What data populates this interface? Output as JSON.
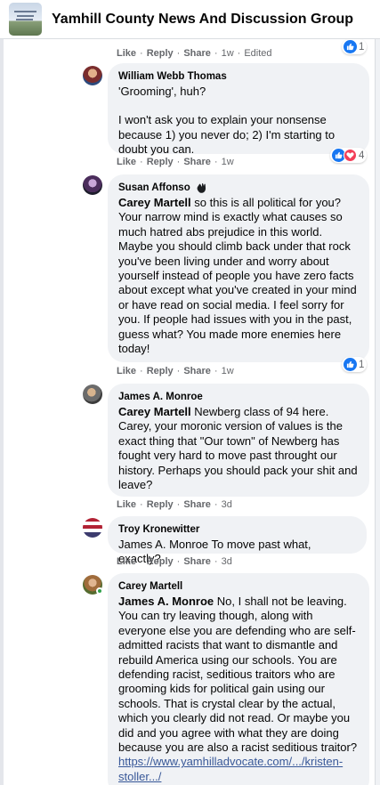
{
  "header": {
    "group_title": "Yamhill County News And Discussion Group"
  },
  "top_actions": {
    "like": "Like",
    "reply": "Reply",
    "share": "Share",
    "time": "1w",
    "edited": "Edited",
    "reaction_count": "1"
  },
  "comments": [
    {
      "author": "William Webb Thomas",
      "lines": [
        "'Grooming', huh?",
        "I won't ask you to explain your nonsense because 1) you never do; 2) I'm starting to doubt you can."
      ],
      "like": "Like",
      "reply": "Reply",
      "share": "Share",
      "time": "1w",
      "reaction_count": "4"
    },
    {
      "author": "Susan Affonso",
      "mention": "Carey Martell",
      "text": "so this is all political for you? Your narrow mind is exactly what causes so much hatred abs prejudice in this world. Maybe you should climb back under that rock you've been living under and worry about yourself instead of people you have zero facts about except what you've created in your mind or have read on social media. I feel sorry for you. If people had issues with you in the past, guess what? You made more enemies here today!",
      "like": "Like",
      "reply": "Reply",
      "share": "Share",
      "time": "1w",
      "reaction_count": "1"
    },
    {
      "author": "James A. Monroe",
      "mention": "Carey Martell",
      "text": "Newberg class of 94 here. Carey, your moronic version of values is the exact thing that \"Our town\" of Newberg has fought very hard to move past throught our history. Perhaps you should pack your shit and leave?",
      "like": "Like",
      "reply": "Reply",
      "share": "Share",
      "time": "3d"
    },
    {
      "author": "Troy Kronewitter",
      "text": "James A. Monroe To move past what, exactly?",
      "like": "Like",
      "reply": "Reply",
      "share": "Share",
      "time": "3d"
    },
    {
      "author": "Carey Martell",
      "mention": "James A. Monroe",
      "text": "No, I shall not be leaving. You can try leaving though, along with everyone else you are defending who are self-admitted racists that want to dismantle and rebuild America using our schools. You are defending racist, seditious traitors who are grooming kids for political gain using our schools. That is crystal clear by the actual, which you clearly did not read. Or maybe you did and you agree with what they are doing because you are also a racist seditious traitor?",
      "link": "https://www.yamhilladvocate.com/.../kristen-stoller.../"
    }
  ],
  "colors": {
    "bubble": "#f0f2f5",
    "link": "#385898",
    "like_blue": "#1877f2",
    "love_red": "#f33e58",
    "online_green": "#31a24c"
  },
  "icons": {
    "like": "thumbs-up-icon",
    "love": "heart-icon",
    "wave": "waving-hand-icon"
  }
}
